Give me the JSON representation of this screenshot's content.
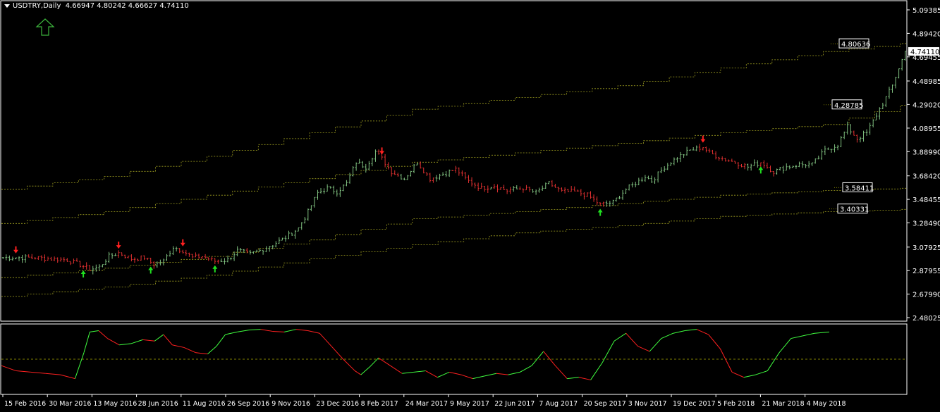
{
  "header": {
    "symbol": "USDTRY,Daily",
    "ohlc": "4.66947 4.80242 4.66627 4.74110"
  },
  "colors": {
    "background": "#000000",
    "frame": "#ffffff",
    "up": "#7fbf7f",
    "down": "#e03030",
    "up_arrow": "#20e020",
    "down_arrow": "#ff2020",
    "band": "#a0a020",
    "level": "#808000",
    "osc_up": "#40ff40",
    "osc_down": "#ff2020",
    "osc_mid": "#808000",
    "big_arrow": "#3cb43c"
  },
  "chart_data": [
    {
      "type": "candlestick",
      "price_axis_ticks": [
        "5.09385",
        "4.89420",
        "4.69455",
        "4.48985",
        "4.29020",
        "4.08955",
        "3.88990",
        "3.68420",
        "3.48455",
        "3.28490",
        "3.07925",
        "2.87955",
        "2.67990",
        "2.48025"
      ],
      "ylim": [
        2.48025,
        5.09385
      ],
      "current_price": "4.74110",
      "date_axis_ticks": [
        "15 Feb 2016",
        "30 Mar 2016",
        "13 May 2016",
        "28 Jun 2016",
        "11 Aug 2016",
        "26 Sep 2016",
        "9 Nov 2016",
        "23 Dec 2016",
        "8 Feb 2017",
        "24 Mar 2017",
        "9 May 2017",
        "22 Jun 2017",
        "7 Aug 2017",
        "20 Sep 2017",
        "3 Nov 2017",
        "19 Dec 2017",
        "5 Feb 2018",
        "21 Mar 2018",
        "4 May 2018"
      ],
      "price_path": [
        [
          0,
          2.99
        ],
        [
          10,
          2.99
        ],
        [
          20,
          2.97
        ],
        [
          24,
          2.93
        ],
        [
          27,
          2.89
        ],
        [
          30,
          2.91
        ],
        [
          33,
          3.0
        ],
        [
          36,
          3.03
        ],
        [
          40,
          2.98
        ],
        [
          44,
          2.99
        ],
        [
          47,
          2.93
        ],
        [
          50,
          2.96
        ],
        [
          53,
          3.08
        ],
        [
          56,
          3.05
        ],
        [
          59,
          2.99
        ],
        [
          62,
          3.0
        ],
        [
          66,
          2.96
        ],
        [
          70,
          2.97
        ],
        [
          73,
          3.05
        ],
        [
          77,
          3.02
        ],
        [
          80,
          3.05
        ],
        [
          84,
          3.1
        ],
        [
          88,
          3.16
        ],
        [
          92,
          3.24
        ],
        [
          95,
          3.38
        ],
        [
          98,
          3.54
        ],
        [
          101,
          3.58
        ],
        [
          104,
          3.55
        ],
        [
          107,
          3.62
        ],
        [
          110,
          3.8
        ],
        [
          113,
          3.76
        ],
        [
          116,
          3.89
        ],
        [
          118,
          3.83
        ],
        [
          121,
          3.72
        ],
        [
          125,
          3.66
        ],
        [
          129,
          3.8
        ],
        [
          133,
          3.66
        ],
        [
          137,
          3.7
        ],
        [
          141,
          3.74
        ],
        [
          145,
          3.64
        ],
        [
          149,
          3.58
        ],
        [
          153,
          3.6
        ],
        [
          157,
          3.56
        ],
        [
          162,
          3.58
        ],
        [
          166,
          3.54
        ],
        [
          170,
          3.62
        ],
        [
          174,
          3.55
        ],
        [
          178,
          3.55
        ],
        [
          182,
          3.52
        ],
        [
          186,
          3.44
        ],
        [
          190,
          3.46
        ],
        [
          194,
          3.57
        ],
        [
          198,
          3.64
        ],
        [
          200,
          3.68
        ],
        [
          202,
          3.64
        ],
        [
          206,
          3.76
        ],
        [
          210,
          3.84
        ],
        [
          214,
          3.9
        ],
        [
          218,
          3.93
        ],
        [
          220,
          3.88
        ],
        [
          224,
          3.83
        ],
        [
          228,
          3.8
        ],
        [
          232,
          3.76
        ],
        [
          236,
          3.8
        ],
        [
          240,
          3.72
        ],
        [
          244,
          3.76
        ],
        [
          248,
          3.78
        ],
        [
          252,
          3.78
        ],
        [
          256,
          3.9
        ],
        [
          260,
          3.95
        ],
        [
          263,
          4.1
        ],
        [
          266,
          4.0
        ],
        [
          269,
          4.05
        ],
        [
          272,
          4.2
        ],
        [
          275,
          4.35
        ],
        [
          277,
          4.45
        ],
        [
          279,
          4.6
        ],
        [
          281,
          4.74
        ]
      ],
      "bands": [
        {
          "name": "upper",
          "path": [
            [
              0,
              3.57
            ],
            [
              32,
              3.68
            ],
            [
              64,
              3.85
            ],
            [
              96,
              4.05
            ],
            [
              128,
              4.25
            ],
            [
              160,
              4.35
            ],
            [
              192,
              4.45
            ],
            [
              224,
              4.6
            ],
            [
              256,
              4.74
            ],
            [
              281,
              4.81
            ]
          ]
        },
        {
          "name": "mid",
          "path": [
            [
              0,
              3.28
            ],
            [
              32,
              3.38
            ],
            [
              64,
              3.52
            ],
            [
              96,
              3.66
            ],
            [
              128,
              3.8
            ],
            [
              160,
              3.88
            ],
            [
              192,
              3.96
            ],
            [
              224,
              4.05
            ],
            [
              256,
              4.12
            ],
            [
              281,
              4.29
            ]
          ]
        },
        {
          "name": "lower-a",
          "path": [
            [
              0,
              2.82
            ],
            [
              32,
              2.9
            ],
            [
              64,
              3.0
            ],
            [
              96,
              3.14
            ],
            [
              128,
              3.32
            ],
            [
              160,
              3.38
            ],
            [
              192,
              3.45
            ],
            [
              224,
              3.52
            ],
            [
              256,
              3.56
            ],
            [
              281,
              3.58
            ]
          ]
        },
        {
          "name": "lower-b",
          "path": [
            [
              0,
              2.66
            ],
            [
              32,
              2.74
            ],
            [
              64,
              2.84
            ],
            [
              96,
              2.98
            ],
            [
              128,
              3.1
            ],
            [
              160,
              3.2
            ],
            [
              192,
              3.26
            ],
            [
              224,
              3.34
            ],
            [
              256,
              3.38
            ],
            [
              281,
              3.4
            ]
          ]
        }
      ],
      "level_labels": [
        {
          "text": "4.80636",
          "value": 4.80636
        },
        {
          "text": "4.28785",
          "value": 4.28785
        },
        {
          "text": "3.58411",
          "value": 3.58411
        },
        {
          "text": "3.40331",
          "value": 3.40331
        }
      ],
      "arrows": [
        {
          "bar": 4,
          "dir": "down"
        },
        {
          "bar": 25,
          "dir": "up"
        },
        {
          "bar": 36,
          "dir": "down"
        },
        {
          "bar": 46,
          "dir": "up"
        },
        {
          "bar": 56,
          "dir": "down"
        },
        {
          "bar": 66,
          "dir": "up"
        },
        {
          "bar": 118,
          "dir": "down"
        },
        {
          "bar": 186,
          "dir": "up"
        },
        {
          "bar": 218,
          "dir": "down"
        },
        {
          "bar": 236,
          "dir": "up"
        }
      ]
    },
    {
      "type": "line",
      "name": "oscillator",
      "ylim": [
        0,
        100
      ],
      "midline": 50,
      "x": [
        0,
        5,
        10,
        15,
        20,
        25,
        28,
        30,
        33,
        36,
        40,
        44,
        48,
        52,
        55,
        58,
        62,
        66,
        70,
        73,
        76,
        80,
        84,
        88,
        92,
        96,
        100,
        104,
        108,
        112,
        116,
        120,
        122,
        125,
        128,
        132,
        136,
        140,
        144,
        148,
        152,
        156,
        160,
        164,
        168,
        172,
        176,
        180,
        184,
        188,
        192,
        196,
        200,
        204,
        208,
        212,
        216,
        220,
        224,
        228,
        232,
        236,
        240,
        244,
        248,
        252,
        256,
        260,
        264,
        268,
        272,
        276,
        281
      ],
      "values": [
        40,
        32,
        30,
        28,
        26,
        20,
        60,
        92,
        94,
        82,
        72,
        74,
        80,
        78,
        88,
        72,
        68,
        60,
        58,
        70,
        88,
        92,
        95,
        96,
        93,
        92,
        96,
        94,
        90,
        70,
        50,
        32,
        26,
        38,
        52,
        40,
        28,
        30,
        32,
        22,
        30,
        26,
        20,
        24,
        28,
        26,
        30,
        40,
        62,
        40,
        20,
        22,
        18,
        45,
        78,
        90,
        70,
        62,
        82,
        90,
        94,
        96,
        88,
        66,
        30,
        22,
        26,
        32,
        60,
        82,
        86,
        90,
        92
      ]
    }
  ]
}
